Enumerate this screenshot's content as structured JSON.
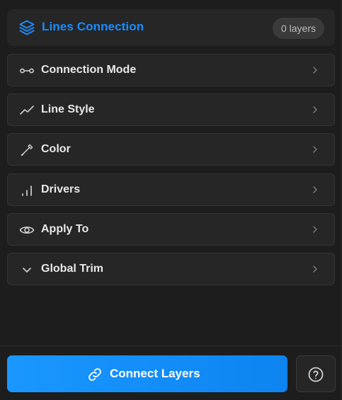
{
  "header": {
    "title": "Lines Connection",
    "layers_badge": "0 layers",
    "icon": "layers-icon"
  },
  "sections": [
    {
      "label": "Connection Mode",
      "icon": "connection-nodes-icon"
    },
    {
      "label": "Line Style",
      "icon": "trend-line-icon"
    },
    {
      "label": "Color",
      "icon": "eyedropper-icon"
    },
    {
      "label": "Drivers",
      "icon": "bar-signal-icon"
    },
    {
      "label": "Apply To",
      "icon": "eye-icon"
    },
    {
      "label": "Global Trim",
      "icon": "chevron-down-icon"
    }
  ],
  "footer": {
    "connect_label": "Connect Layers",
    "connect_icon": "link-icon",
    "help_icon": "help-circle-icon"
  },
  "colors": {
    "accent": "#1a8cff",
    "background": "#1d1d1d",
    "card": "#262626",
    "text": "#e8e8e8",
    "muted": "#8a8a8a"
  }
}
